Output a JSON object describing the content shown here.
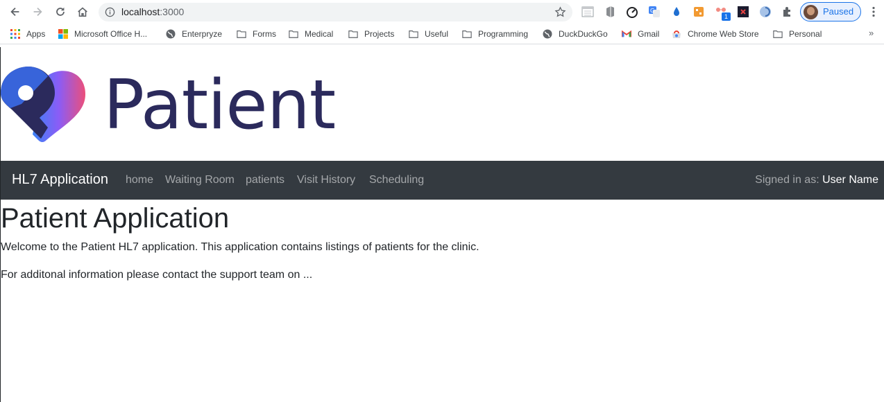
{
  "browser": {
    "url_host": "localhost",
    "url_port": ":3000",
    "profile_label": "Paused",
    "bookmarks": [
      {
        "label": "Apps",
        "icon": "apps-grid-icon"
      },
      {
        "label": "Microsoft Office H...",
        "icon": "microsoft-icon"
      },
      {
        "label": "Enterpryze",
        "icon": "globe-icon"
      },
      {
        "label": "Forms",
        "icon": "folder-icon"
      },
      {
        "label": "Medical",
        "icon": "folder-icon"
      },
      {
        "label": "Projects",
        "icon": "folder-icon"
      },
      {
        "label": "Useful",
        "icon": "folder-icon"
      },
      {
        "label": "Programming",
        "icon": "folder-icon"
      },
      {
        "label": "DuckDuckGo",
        "icon": "globe-icon"
      },
      {
        "label": "Gmail",
        "icon": "gmail-icon"
      },
      {
        "label": "Chrome Web Store",
        "icon": "chrome-web-store-icon"
      },
      {
        "label": "Personal",
        "icon": "folder-icon"
      }
    ],
    "extension_badge": "1",
    "more_bookmarks": "»"
  },
  "page": {
    "logo_text": "Patient",
    "navbar": {
      "brand": "HL7 Application",
      "links": [
        "home",
        "Waiting Room",
        "patients",
        "Visit History",
        "Scheduling"
      ],
      "signed_in_prefix": "Signed in as: ",
      "user_name": "User Name"
    },
    "title": "Patient Application",
    "paragraph1": "Welcome to the Patient HL7 application. This application contains listings of patients for the clinic.",
    "paragraph2": "For additonal information please contact the support team on ..."
  },
  "colors": {
    "navbar_bg": "#343a40",
    "logo_text": "#2b2a5c",
    "logo_gradient_start": "#3b82f6",
    "logo_gradient_end": "#ec4f7a",
    "profile_accent": "#1a73e8"
  }
}
